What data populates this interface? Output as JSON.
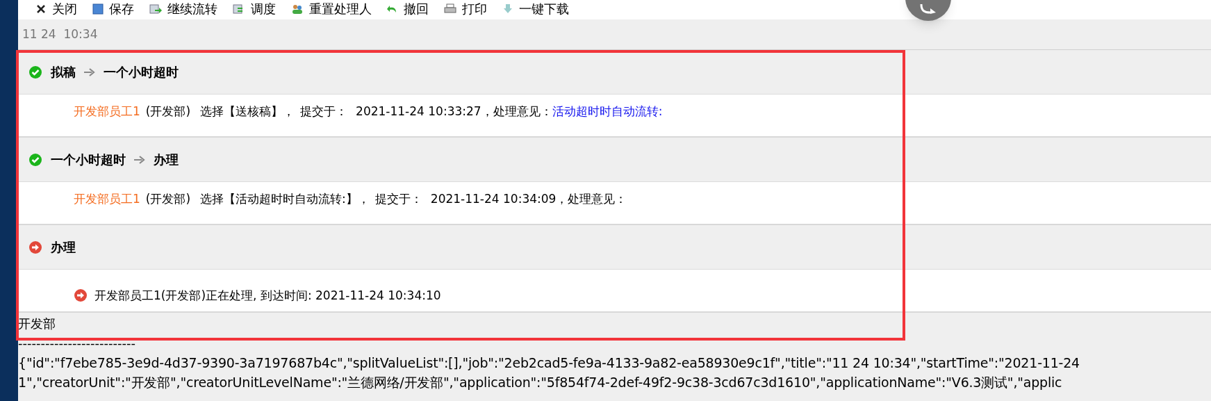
{
  "toolbar": [
    {
      "label": "关闭",
      "kind": "close"
    },
    {
      "label": "保存",
      "kind": "save"
    },
    {
      "label": "继续流转",
      "kind": "forward"
    },
    {
      "label": "调度",
      "kind": "dispatch"
    },
    {
      "label": "重置处理人",
      "kind": "people"
    },
    {
      "label": "撤回",
      "kind": "undo"
    },
    {
      "label": "打印",
      "kind": "print"
    },
    {
      "label": "一键下载",
      "kind": "download"
    }
  ],
  "doc_title": "11 24  10:34",
  "steps": [
    {
      "kind": "done",
      "from": "拟稿",
      "to": "一个小时超时",
      "record": {
        "user": "开发部员工1",
        "dept": "(开发部)",
        "action": "选择【送核稿】，",
        "submit_label": "提交于：",
        "time": "2021-11-24 10:33:27，",
        "opinion_label": "处理意见：",
        "opinion": "活动超时时自动流转:"
      }
    },
    {
      "kind": "done",
      "from": "一个小时超时",
      "to": "办理",
      "record": {
        "user": "开发部员工1",
        "dept": "(开发部)",
        "action": "选择【活动超时时自动流转:】，",
        "submit_label": "提交于：",
        "time": "2021-11-24 10:34:09，",
        "opinion_label": "处理意见："
      }
    },
    {
      "kind": "current",
      "from": "办理",
      "record": {
        "text": "开发部员工1(开发部)正在处理, 到达时间: 2021-11-24 10:34:10"
      }
    }
  ],
  "unit_line": "开发部",
  "separator": "--------------------------",
  "json_lines": [
    "{\"id\":\"f7ebe785-3e9d-4d37-9390-3a7197687b4c\",\"splitValueList\":[],\"job\":\"2eb2cad5-fe9a-4133-9a82-ea58930e9c1f\",\"title\":\"11 24 10:34\",\"startTime\":\"2021-11-24",
    "1\",\"creatorUnit\":\"开发部\",\"creatorUnitLevelName\":\"兰德网络/开发部\",\"application\":\"5f854f74-2def-49f2-9c38-3cd67c3d1610\",\"applicationName\":\"V6.3测试\",\"applic"
  ]
}
